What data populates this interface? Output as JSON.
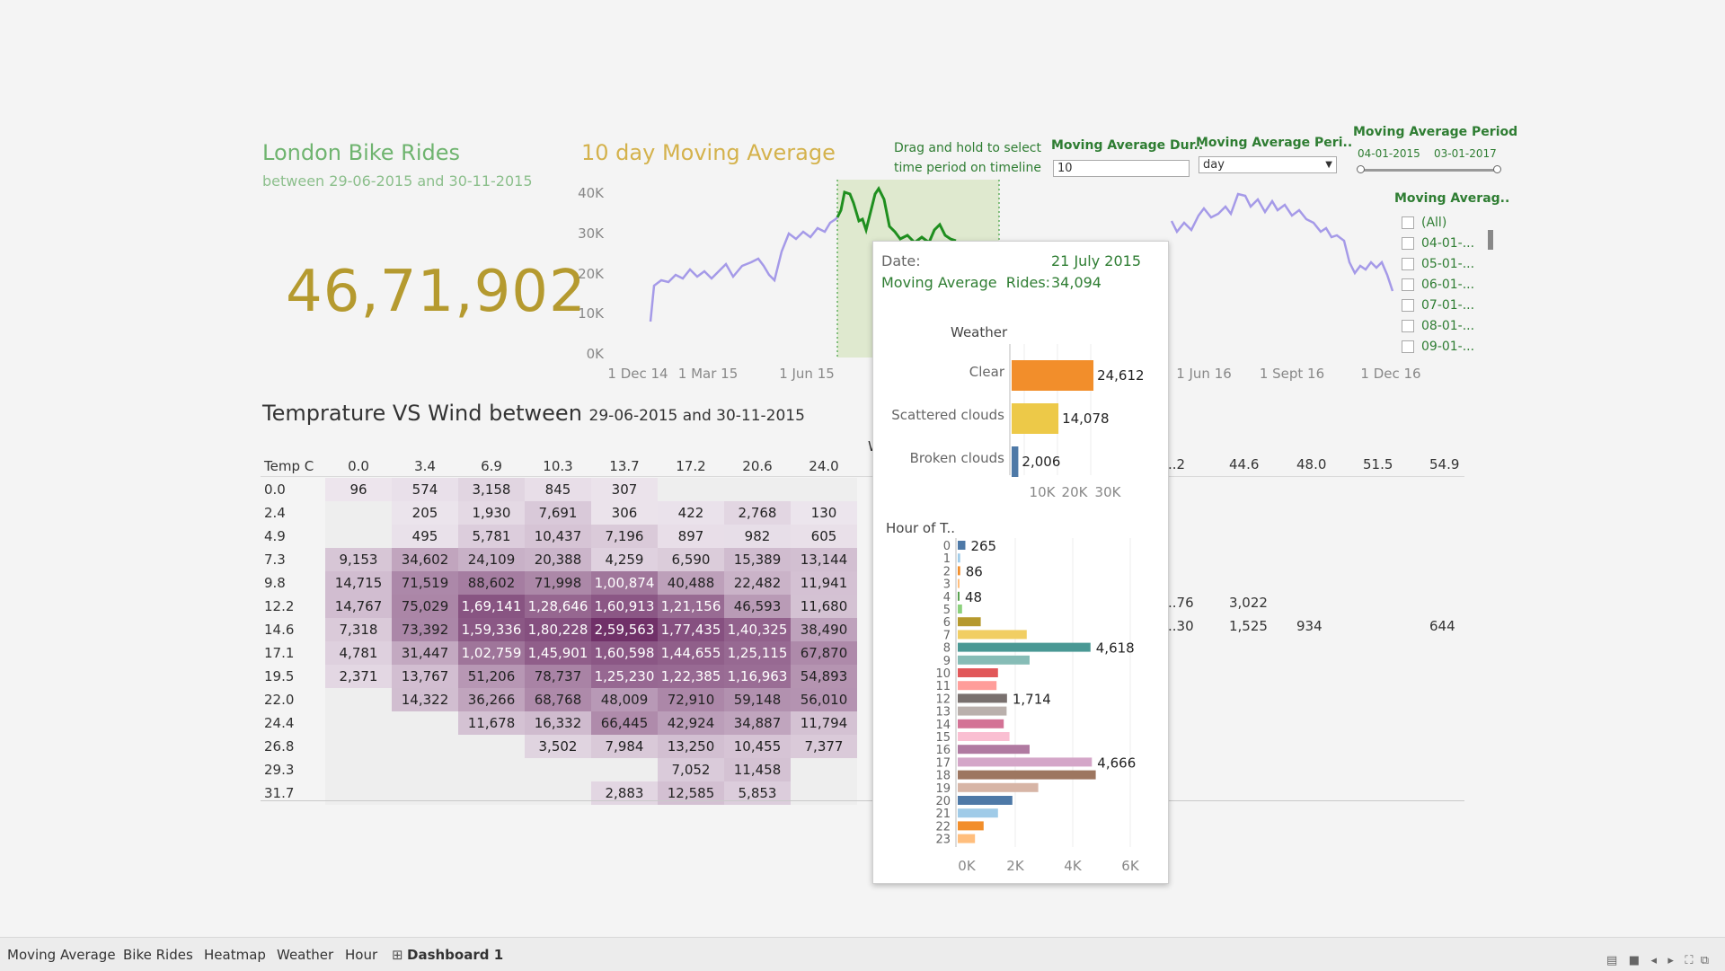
{
  "dashboard": {
    "title": "London Bike Rides",
    "subtitle": "between 29-06-2015 and 30-11-2015",
    "total": "46,71,902"
  },
  "moving_average": {
    "title": "10 day Moving Average",
    "hint": "Drag and hold to select time period on timeline",
    "y_ticks": [
      "40K",
      "30K",
      "20K",
      "10K",
      "0K"
    ],
    "x_ticks": [
      "1 Dec 14",
      "1 Mar 15",
      "1 Jun 15",
      "1 Jun 16",
      "1 Sept 16",
      "1 Dec 16"
    ],
    "colors": {
      "line": "#a59ae8",
      "highlight": "#1f8f1f",
      "selection": "#dfe9cf"
    }
  },
  "controls": {
    "duration_label": "Moving Average Dur..",
    "duration_value": "10",
    "period_label": "Moving Average Peri..",
    "period_value": "day",
    "range_label": "Moving Average Period",
    "range_start": "04-01-2015",
    "range_end": "03-01-2017",
    "filter_label": "Moving Averag..",
    "filter_items": [
      "(All)",
      "04-01-...",
      "05-01-...",
      "06-01-...",
      "07-01-...",
      "08-01-...",
      "09-01-..."
    ]
  },
  "heatmap": {
    "title": "Temprature VS Wind between",
    "subtitle": "29-06-2015 and 30-11-2015",
    "corner": "Temp C",
    "columns": [
      "0.0",
      "3.4",
      "6.9",
      "10.3",
      "13.7",
      "17.2",
      "20.6",
      "24.0"
    ],
    "right_columns": [
      "..2",
      "44.6",
      "48.0",
      "51.5",
      "54.9"
    ],
    "hidden_header_fragment": "W",
    "rows": [
      {
        "label": "0.0",
        "cells": [
          "96",
          "574",
          "3,158",
          "845",
          "307",
          "",
          "",
          ""
        ]
      },
      {
        "label": "2.4",
        "cells": [
          "",
          "205",
          "1,930",
          "7,691",
          "306",
          "422",
          "2,768",
          "130"
        ]
      },
      {
        "label": "4.9",
        "cells": [
          "",
          "495",
          "5,781",
          "10,437",
          "7,196",
          "897",
          "982",
          "605"
        ]
      },
      {
        "label": "7.3",
        "cells": [
          "9,153",
          "34,602",
          "24,109",
          "20,388",
          "4,259",
          "6,590",
          "15,389",
          "13,144"
        ]
      },
      {
        "label": "9.8",
        "cells": [
          "14,715",
          "71,519",
          "88,602",
          "71,998",
          "1,00,874",
          "40,488",
          "22,482",
          "11,941"
        ]
      },
      {
        "label": "12.2",
        "cells": [
          "14,767",
          "75,029",
          "1,69,141",
          "1,28,646",
          "1,60,913",
          "1,21,156",
          "46,593",
          "11,680"
        ]
      },
      {
        "label": "14.6",
        "cells": [
          "7,318",
          "73,392",
          "1,59,336",
          "1,80,228",
          "2,59,563",
          "1,77,435",
          "1,40,325",
          "38,490"
        ]
      },
      {
        "label": "17.1",
        "cells": [
          "4,781",
          "31,447",
          "1,02,759",
          "1,45,901",
          "1,60,598",
          "1,44,655",
          "1,25,115",
          "67,870"
        ]
      },
      {
        "label": "19.5",
        "cells": [
          "2,371",
          "13,767",
          "51,206",
          "78,737",
          "1,25,230",
          "1,22,385",
          "1,16,963",
          "54,893"
        ]
      },
      {
        "label": "22.0",
        "cells": [
          "",
          "14,322",
          "36,266",
          "68,768",
          "48,009",
          "72,910",
          "59,148",
          "56,010"
        ]
      },
      {
        "label": "24.4",
        "cells": [
          "",
          "",
          "11,678",
          "16,332",
          "66,445",
          "42,924",
          "34,887",
          "11,794"
        ]
      },
      {
        "label": "26.8",
        "cells": [
          "",
          "",
          "",
          "3,502",
          "7,984",
          "13,250",
          "10,455",
          "7,377"
        ]
      },
      {
        "label": "29.3",
        "cells": [
          "",
          "",
          "",
          "",
          "",
          "7,052",
          "11,458",
          ""
        ]
      },
      {
        "label": "31.7",
        "cells": [
          "",
          "",
          "",
          "",
          "2,883",
          "12,585",
          "5,853",
          ""
        ]
      }
    ],
    "right_cells": [
      {
        "label": "12.2",
        "cells": [
          "..76",
          "3,022",
          "",
          "",
          ""
        ]
      },
      {
        "label": "14.6",
        "cells": [
          "..30",
          "1,525",
          "934",
          "",
          "644"
        ]
      }
    ]
  },
  "tooltip": {
    "date_label": "Date:",
    "date_value": "21 July 2015",
    "ma_label": "Moving Average  Rides:",
    "ma_value": "34,094",
    "weather_title": "Weather",
    "weather": [
      {
        "label": "Clear",
        "value": 24612,
        "text": "24,612",
        "color": "#f28e2b"
      },
      {
        "label": "Scattered clouds",
        "value": 14078,
        "text": "14,078",
        "color": "#edc948"
      },
      {
        "label": "Broken clouds",
        "value": 2006,
        "text": "2,006",
        "color": "#4e79a7"
      }
    ],
    "weather_ticks": [
      "10K",
      "20K",
      "30K"
    ],
    "hour_title": "Hour of T..",
    "hour_ticks": [
      "0K",
      "2K",
      "4K",
      "6K"
    ],
    "hours": [
      {
        "h": "0",
        "value": 265,
        "text": "265",
        "color": "#4e79a7"
      },
      {
        "h": "1",
        "value": 86,
        "text": "",
        "color": "#a0cbe8"
      },
      {
        "h": "2",
        "value": 86,
        "text": "86",
        "color": "#f28e2b"
      },
      {
        "h": "3",
        "value": 20,
        "text": "",
        "color": "#ffbe7d"
      },
      {
        "h": "4",
        "value": 48,
        "text": "48",
        "color": "#59a14f"
      },
      {
        "h": "5",
        "value": 150,
        "text": "",
        "color": "#8cd17d"
      },
      {
        "h": "6",
        "value": 800,
        "text": "",
        "color": "#b6992d"
      },
      {
        "h": "7",
        "value": 2400,
        "text": "",
        "color": "#f1ce63"
      },
      {
        "h": "8",
        "value": 4618,
        "text": "4,618",
        "color": "#499894"
      },
      {
        "h": "9",
        "value": 2500,
        "text": "",
        "color": "#86bcb6"
      },
      {
        "h": "10",
        "value": 1400,
        "text": "",
        "color": "#e15759"
      },
      {
        "h": "11",
        "value": 1350,
        "text": "",
        "color": "#ff9d9a"
      },
      {
        "h": "12",
        "value": 1714,
        "text": "1,714",
        "color": "#79706e"
      },
      {
        "h": "13",
        "value": 1700,
        "text": "",
        "color": "#bab0ac"
      },
      {
        "h": "14",
        "value": 1600,
        "text": "",
        "color": "#d37295"
      },
      {
        "h": "15",
        "value": 1800,
        "text": "",
        "color": "#fabfd2"
      },
      {
        "h": "16",
        "value": 2500,
        "text": "",
        "color": "#b07aa1"
      },
      {
        "h": "17",
        "value": 4666,
        "text": "4,666",
        "color": "#d4a6c8"
      },
      {
        "h": "18",
        "value": 4800,
        "text": "",
        "color": "#9d7660"
      },
      {
        "h": "19",
        "value": 2800,
        "text": "",
        "color": "#d7b5a6"
      },
      {
        "h": "20",
        "value": 1900,
        "text": "",
        "color": "#4e79a7"
      },
      {
        "h": "21",
        "value": 1400,
        "text": "",
        "color": "#a0cbe8"
      },
      {
        "h": "22",
        "value": 900,
        "text": "",
        "color": "#f28e2b"
      },
      {
        "h": "23",
        "value": 600,
        "text": "",
        "color": "#ffbe7d"
      }
    ]
  },
  "tabs": [
    "Moving Average",
    "Bike Rides",
    "Heatmap",
    "Weather",
    "Hour",
    "Dashboard 1"
  ],
  "active_tab": "Dashboard 1",
  "tab_icon": "dashboard-grid-icon",
  "status_icons": [
    "sheet-sort-icon",
    "filmstrip-icon",
    "prev-icon",
    "next-icon",
    "fit-icon",
    "fullscreen-icon"
  ]
}
